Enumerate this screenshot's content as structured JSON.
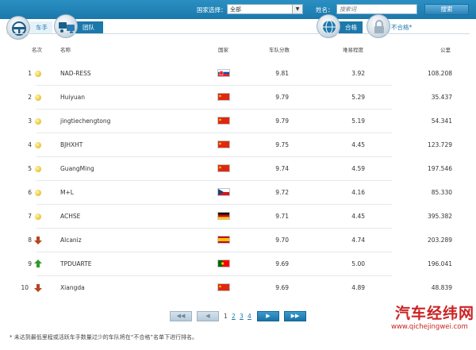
{
  "header": {
    "country_label": "国家选择：",
    "country_value": "全部",
    "name_label": "姓名：",
    "name_placeholder": "搜索词",
    "search_label": "搜索"
  },
  "tabs": {
    "driver": "车手",
    "team": "团队",
    "pass": "合格",
    "fail": "不合格*"
  },
  "table": {
    "headers": {
      "rank": "名次",
      "name": "名称",
      "country": "国家",
      "score": "车队分数",
      "difficulty": "难易程度",
      "km": "公里"
    },
    "rows": [
      {
        "rank": "1",
        "trend": "same",
        "name": "NAD-RESS",
        "flag": "slovakia",
        "score": "9.81",
        "difficulty": "3.92",
        "km": "108.208"
      },
      {
        "rank": "2",
        "trend": "same",
        "name": "Huiyuan",
        "flag": "china",
        "score": "9.79",
        "difficulty": "5.29",
        "km": "35.437"
      },
      {
        "rank": "3",
        "trend": "same",
        "name": "jingtiechengtong",
        "flag": "china",
        "score": "9.79",
        "difficulty": "5.19",
        "km": "54.341"
      },
      {
        "rank": "4",
        "trend": "same",
        "name": "BJHXHT",
        "flag": "china",
        "score": "9.75",
        "difficulty": "4.45",
        "km": "123.729"
      },
      {
        "rank": "5",
        "trend": "same",
        "name": "GuangMing",
        "flag": "china",
        "score": "9.74",
        "difficulty": "4.59",
        "km": "197.546"
      },
      {
        "rank": "6",
        "trend": "same",
        "name": "M+L",
        "flag": "czech",
        "score": "9.72",
        "difficulty": "4.16",
        "km": "85.330"
      },
      {
        "rank": "7",
        "trend": "same",
        "name": "ACHSE",
        "flag": "germany",
        "score": "9.71",
        "difficulty": "4.45",
        "km": "395.382"
      },
      {
        "rank": "8",
        "trend": "down",
        "name": "Alcaniz",
        "flag": "spain",
        "score": "9.70",
        "difficulty": "4.74",
        "km": "203.289"
      },
      {
        "rank": "9",
        "trend": "up",
        "name": "TPDUARTE",
        "flag": "portugal",
        "score": "9.69",
        "difficulty": "5.00",
        "km": "196.041"
      },
      {
        "rank": "10",
        "trend": "down",
        "name": "Xiangda",
        "flag": "china",
        "score": "9.69",
        "difficulty": "4.89",
        "km": "48.839"
      }
    ]
  },
  "pagination": {
    "first": "◀◀",
    "prev": "◀",
    "next": "▶",
    "last": "▶▶",
    "pages": [
      "1",
      "2",
      "3",
      "4"
    ],
    "current": "1"
  },
  "footnote": "* 未达到最低里程或活跃车手数量过少的车队将在“不合格”名单下进行排名。",
  "watermark": {
    "title": "汽车经纬网",
    "url": "www.qichejingwei.com"
  },
  "colors": {
    "accent": "#1b78ab",
    "up": "#2e9a2e",
    "down": "#b5461f",
    "same": "#e8c235"
  }
}
